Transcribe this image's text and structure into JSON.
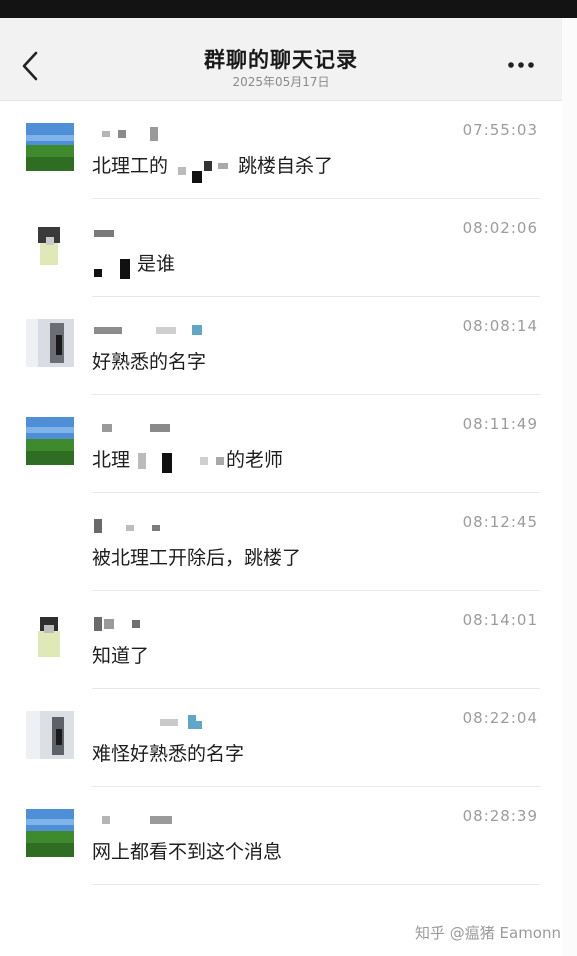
{
  "header": {
    "title": "群聊的聊天记录",
    "date": "2025年05月17日"
  },
  "messages": [
    {
      "time": "07:55:03",
      "text_a": "北理工的",
      "text_b": "跳楼自杀了"
    },
    {
      "time": "08:02:06",
      "text_a": "是谁"
    },
    {
      "time": "08:08:14",
      "text_a": "好熟悉的名字"
    },
    {
      "time": "08:11:49",
      "text_a": "北理",
      "text_b": "的老师"
    },
    {
      "time": "08:12:45",
      "text_a": "被北理工开除后，跳楼了"
    },
    {
      "time": "08:14:01",
      "text_a": "知道了"
    },
    {
      "time": "08:22:04",
      "text_a": "难怪好熟悉的名字"
    },
    {
      "time": "08:28:39",
      "text_a": "网上都看不到这个消息"
    }
  ],
  "watermark": "知乎 @瘟猪 Eamonn",
  "icons": {
    "back": "chevron-left-icon",
    "more": "more-dots-icon"
  },
  "colors": {
    "header_bg": "#f2f2f2",
    "time": "#9c9c9c",
    "divider": "#e9e9e9"
  }
}
